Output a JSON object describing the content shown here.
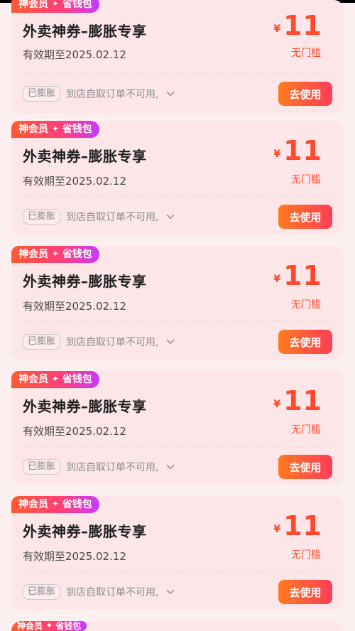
{
  "coupons": [
    {
      "badge_left": "神会员",
      "badge_mid": "✦",
      "badge_right": "省钱包",
      "title": "外卖神券–膨胀专享",
      "valid_text": "有效期至2025.02.12",
      "currency": "¥",
      "amount": "11",
      "threshold": "无门槛",
      "tag": "已膨胀",
      "note": "到店自取订单不可用,",
      "cta": "去使用"
    },
    {
      "badge_left": "神会员",
      "badge_mid": "✦",
      "badge_right": "省钱包",
      "title": "外卖神券–膨胀专享",
      "valid_text": "有效期至2025.02.12",
      "currency": "¥",
      "amount": "11",
      "threshold": "无门槛",
      "tag": "已膨胀",
      "note": "到店自取订单不可用,",
      "cta": "去使用"
    },
    {
      "badge_left": "神会员",
      "badge_mid": "✦",
      "badge_right": "省钱包",
      "title": "外卖神券–膨胀专享",
      "valid_text": "有效期至2025.02.12",
      "currency": "¥",
      "amount": "11",
      "threshold": "无门槛",
      "tag": "已膨胀",
      "note": "到店自取订单不可用,",
      "cta": "去使用"
    },
    {
      "badge_left": "神会员",
      "badge_mid": "✦",
      "badge_right": "省钱包",
      "title": "外卖神券–膨胀专享",
      "valid_text": "有效期至2025.02.12",
      "currency": "¥",
      "amount": "11",
      "threshold": "无门槛",
      "tag": "已膨胀",
      "note": "到店自取订单不可用,",
      "cta": "去使用"
    },
    {
      "badge_left": "神会员",
      "badge_mid": "✦",
      "badge_right": "省钱包",
      "title": "外卖神券–膨胀专享",
      "valid_text": "有效期至2025.02.12",
      "currency": "¥",
      "amount": "11",
      "threshold": "无门槛",
      "tag": "已膨胀",
      "note": "到店自取订单不可用,",
      "cta": "去使用"
    }
  ],
  "peek_badge": {
    "left": "神会员",
    "mid": "✦",
    "right": "省钱包"
  },
  "icons": {
    "chevron": "chevron-down-icon",
    "sparkle": "sparkle-icon"
  },
  "colors": {
    "page_bg": "#fbeff0",
    "card_bg": "#fde6e8",
    "accent": "#ff4a2e",
    "button_start": "#ff7a1f",
    "button_end": "#ff3d58"
  }
}
